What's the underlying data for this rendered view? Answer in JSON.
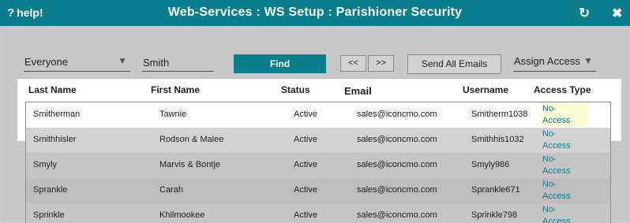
{
  "titlebar": {
    "help_label": "help!",
    "title": "Web-Services : WS Setup : Parishioner Security",
    "refresh_icon": "refresh-icon",
    "close_icon": "close-icon"
  },
  "filters": {
    "group_select": "Everyone",
    "name_value": "Smith",
    "find_label": "Find",
    "prev_label": "<<",
    "next_label": ">>",
    "send_all_label": "Send All Emails",
    "assign_access_label": "Assign Access"
  },
  "table": {
    "headers": {
      "last_name": "Last Name",
      "first_name": "First Name",
      "status": "Status",
      "email": "Email",
      "username": "Username",
      "access_type": "Access Type"
    },
    "rows": [
      {
        "last": "Smitherman",
        "first": "Tawnie",
        "status": "Active",
        "email": "sales@iconcmo.com",
        "username": "Smitherm1038",
        "access_1": "No-",
        "access_2": "Access",
        "selected": true
      },
      {
        "last": "Smithhisler",
        "first": "Rodson & Malee",
        "status": "Active",
        "email": "sales@iconcmo.com",
        "username": "Smithhis1032",
        "access_1": "No-",
        "access_2": "Access",
        "selected": false
      },
      {
        "last": "Smyly",
        "first": "Marvis & Bontje",
        "status": "Active",
        "email": "sales@iconcmo.com",
        "username": "Smyly986",
        "access_1": "No-",
        "access_2": "Access",
        "selected": false
      },
      {
        "last": "Sprankle",
        "first": "Carah",
        "status": "Active",
        "email": "sales@iconcmo.com",
        "username": "Sprankle671",
        "access_1": "No-",
        "access_2": "Access",
        "selected": false
      },
      {
        "last": "Sprinkle",
        "first": "Khilmookee",
        "status": "Active",
        "email": "sales@iconcmo.com",
        "username": "Sprinkle798",
        "access_1": "No-",
        "access_2": "Access",
        "selected": false
      }
    ]
  },
  "colors": {
    "accent": "#0a7e8c",
    "overlay_bg": "#c7c7c7",
    "selected_access_bg": "#fbfbd4"
  }
}
